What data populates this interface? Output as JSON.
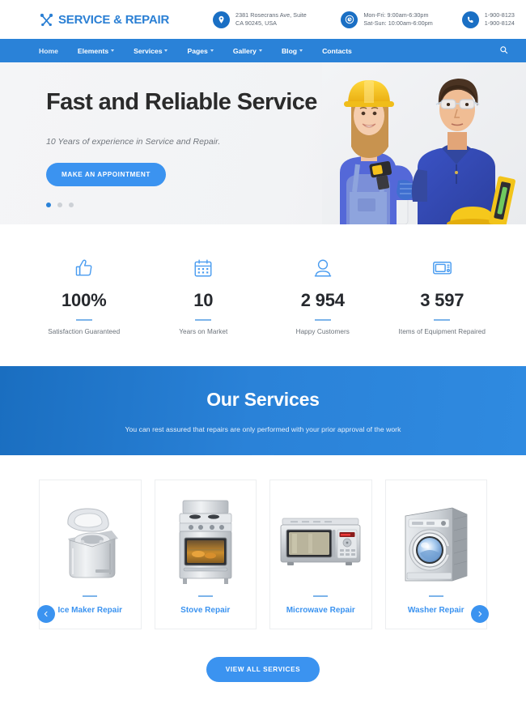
{
  "brand": {
    "name": "SERVICE & REPAIR",
    "logo_icon": "crossed-wrench-screwdriver-icon",
    "accent_color": "#2a82d8",
    "button_color": "#3b93f0"
  },
  "header": {
    "contacts": [
      {
        "icon": "location-pin-icon",
        "line1": "2381 Rosecrans Ave, Suite",
        "line2": "CA 90245, USA"
      },
      {
        "icon": "clock-icon",
        "line1": "Mon-Fri: 9:00am-6:30pm",
        "line2": "Sat-Sun: 10:00am-6:00pm"
      },
      {
        "icon": "phone-icon",
        "line1": "1-900-8123",
        "line2": "1-900-8124"
      }
    ]
  },
  "nav": {
    "items": [
      {
        "label": "Home",
        "has_dropdown": false
      },
      {
        "label": "Elements",
        "has_dropdown": true
      },
      {
        "label": "Services",
        "has_dropdown": true
      },
      {
        "label": "Pages",
        "has_dropdown": true
      },
      {
        "label": "Gallery",
        "has_dropdown": true
      },
      {
        "label": "Blog",
        "has_dropdown": true
      },
      {
        "label": "Contacts",
        "has_dropdown": false
      }
    ],
    "search_icon": "search-icon"
  },
  "hero": {
    "title": "Fast and Reliable Service",
    "subtitle": "10 Years of experience in Service and Repair.",
    "cta_label": "MAKE AN APPOINTMENT",
    "slide_count": 3,
    "active_slide": 1,
    "image_alt": "two-repair-technicians-with-drill-and-hard-hat"
  },
  "stats": [
    {
      "icon": "thumbs-up-icon",
      "value": "100%",
      "label": "Satisfaction Guaranteed"
    },
    {
      "icon": "calendar-icon",
      "value": "10",
      "label": "Years on Market"
    },
    {
      "icon": "person-icon",
      "value": "2 954",
      "label": "Happy Customers"
    },
    {
      "icon": "microwave-icon",
      "value": "3 597",
      "label": "Items of Equipment Repaired"
    }
  ],
  "services_section": {
    "heading": "Our Services",
    "subheading": "You can rest assured that repairs are only performed with your prior approval of the work",
    "prev_label": "‹",
    "next_label": "›",
    "view_all_label": "VIEW ALL SERVICES",
    "cards": [
      {
        "title": "Ice Maker Repair",
        "image": "ice-maker-appliance"
      },
      {
        "title": "Stove Repair",
        "image": "stove-oven-appliance"
      },
      {
        "title": "Microwave Repair",
        "image": "microwave-oven-appliance"
      },
      {
        "title": "Washer Repair",
        "image": "washing-machine-appliance"
      }
    ]
  }
}
